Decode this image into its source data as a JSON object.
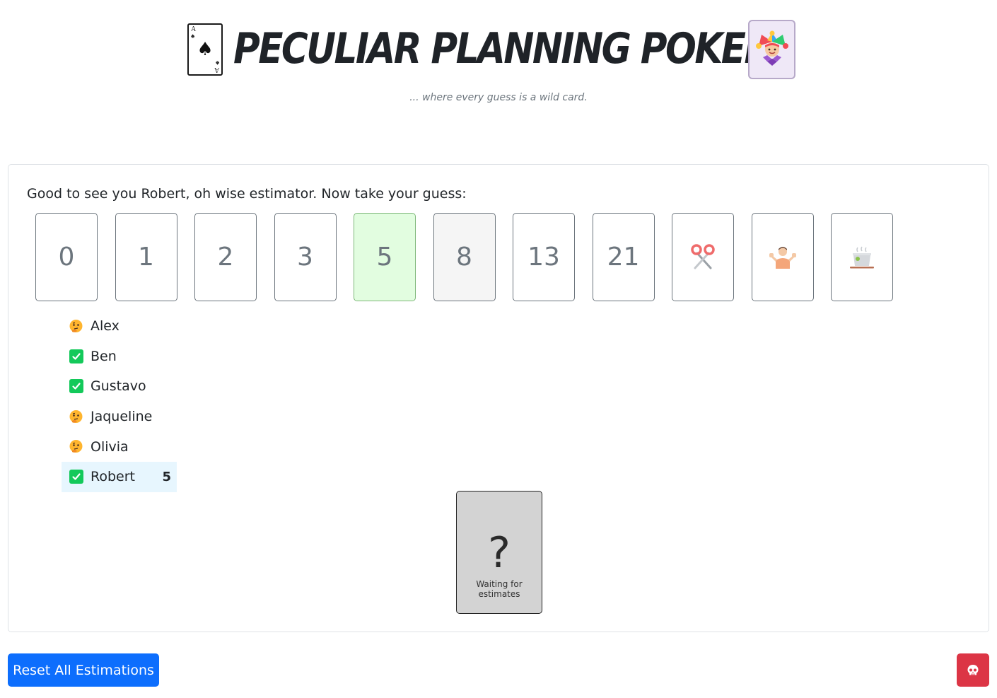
{
  "header": {
    "title": "Peculiar Planning Poker",
    "subtitle": "... where every guess is a wild card.",
    "ace_rank": "A",
    "ace_suit": "♠"
  },
  "greeting": "Good to see you Robert, oh wise estimator. Now take your guess:",
  "cards": [
    {
      "label": "0",
      "kind": "number",
      "state": "default"
    },
    {
      "label": "1",
      "kind": "number",
      "state": "default"
    },
    {
      "label": "2",
      "kind": "number",
      "state": "default"
    },
    {
      "label": "3",
      "kind": "number",
      "state": "default"
    },
    {
      "label": "5",
      "kind": "number",
      "state": "selected"
    },
    {
      "label": "8",
      "kind": "number",
      "state": "hovered"
    },
    {
      "label": "13",
      "kind": "number",
      "state": "default"
    },
    {
      "label": "21",
      "kind": "number",
      "state": "default"
    },
    {
      "label": "",
      "kind": "icon",
      "icon": "scissors-icon",
      "state": "default"
    },
    {
      "label": "",
      "kind": "icon",
      "icon": "shrug-icon",
      "state": "default"
    },
    {
      "label": "",
      "kind": "icon",
      "icon": "coffee-break-icon",
      "state": "default"
    }
  ],
  "players": [
    {
      "name": "Alex",
      "status": "thinking",
      "vote": ""
    },
    {
      "name": "Ben",
      "status": "voted",
      "vote": ""
    },
    {
      "name": "Gustavo",
      "status": "voted",
      "vote": ""
    },
    {
      "name": "Jaqueline",
      "status": "thinking",
      "vote": ""
    },
    {
      "name": "Olivia",
      "status": "thinking",
      "vote": ""
    },
    {
      "name": "Robert",
      "status": "voted",
      "vote": "5",
      "is_me": true
    }
  ],
  "result": {
    "symbol": "?",
    "label": "Waiting for estimates"
  },
  "actions": {
    "reset_label": "Reset All Estimations",
    "danger_icon": "skull-icon"
  },
  "colors": {
    "primary": "#0d6efd",
    "danger": "#dc3545",
    "selected_card": "#e2fde0",
    "voted_check": "#13c95a",
    "me_highlight": "#e7f6fe"
  }
}
